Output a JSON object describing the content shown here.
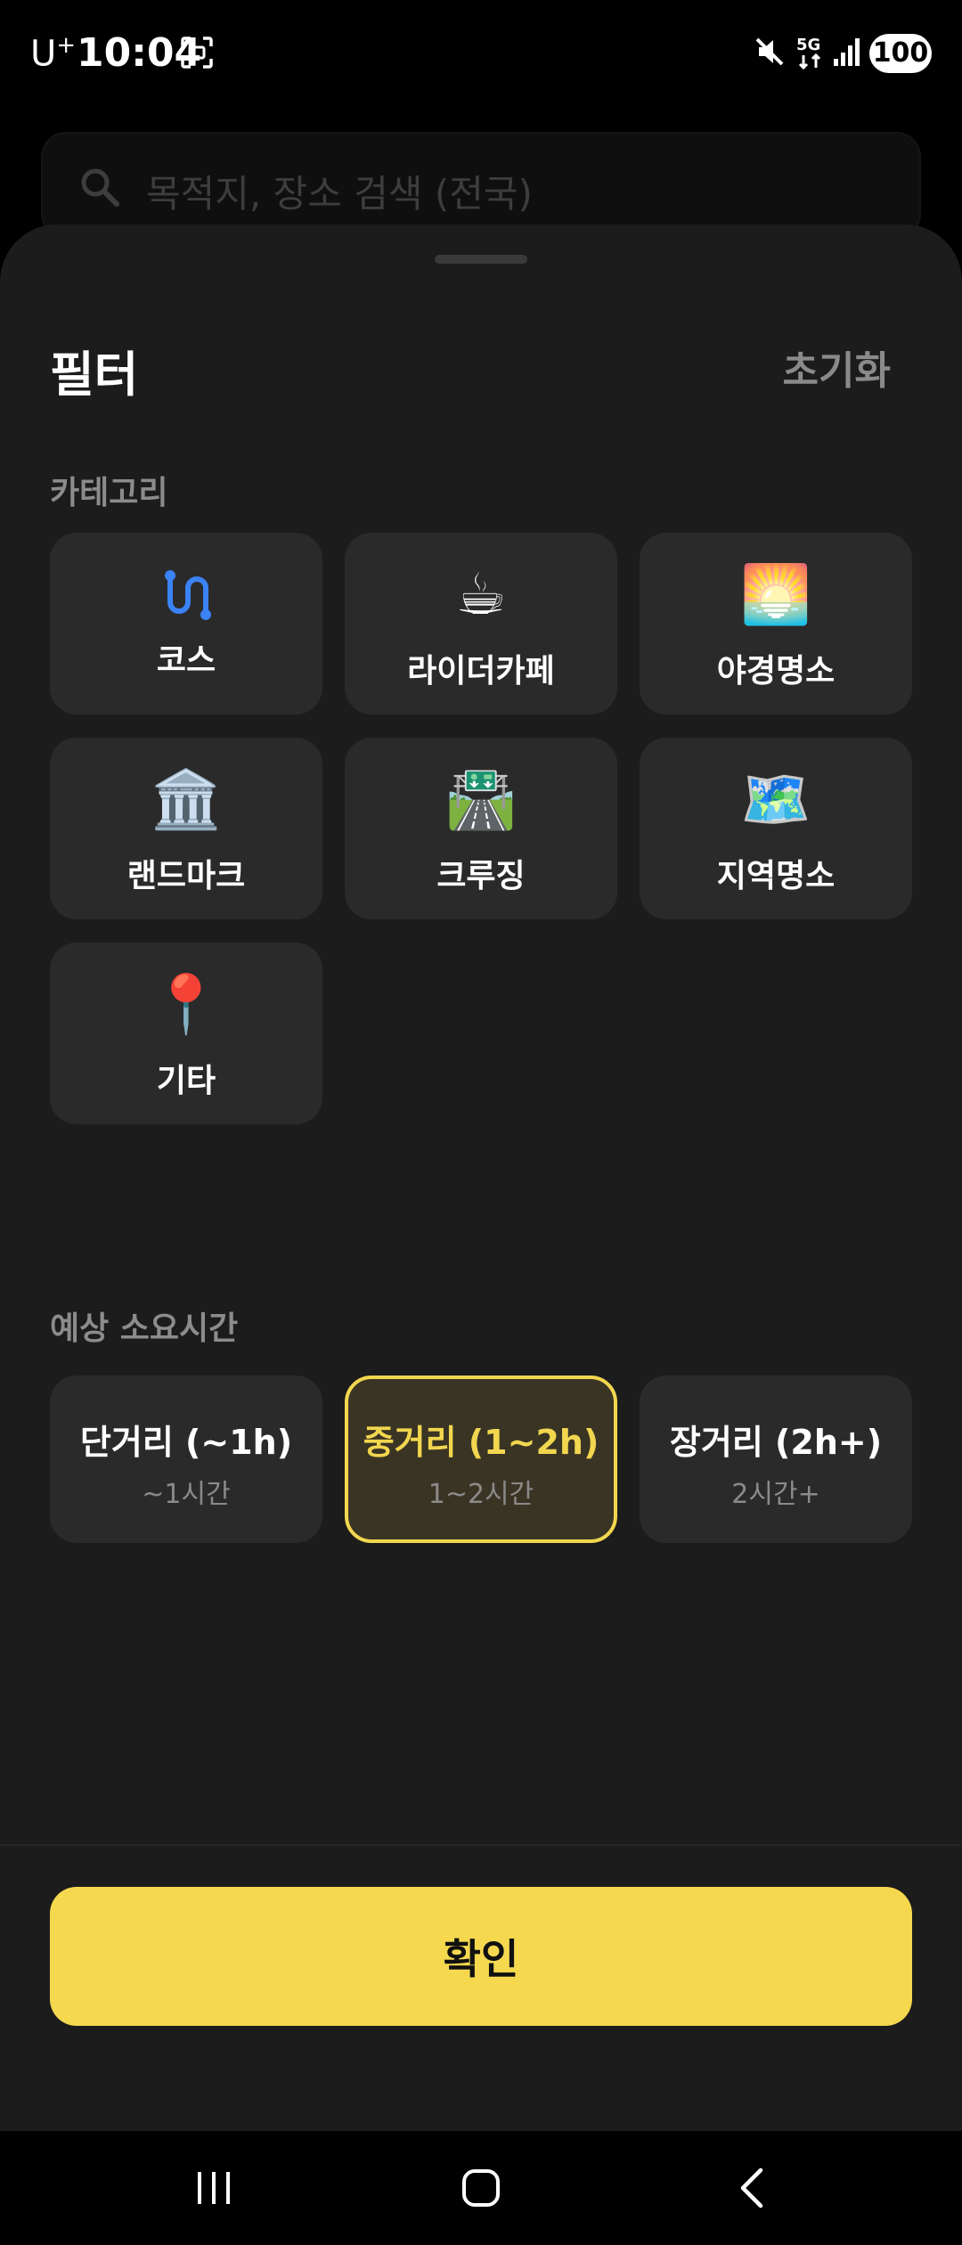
{
  "status_bar": {
    "carrier": "U",
    "carrier_sup": "+",
    "time": "10:04",
    "network": "5G",
    "battery": "100"
  },
  "search": {
    "placeholder": "목적지, 장소 검색 (전국)"
  },
  "sheet": {
    "title": "필터",
    "reset_label": "초기화",
    "category_label": "카테고리",
    "categories": [
      {
        "label": "코스",
        "icon": "route-icon"
      },
      {
        "label": "라이더카페",
        "icon": "coffee-icon",
        "emoji": "☕"
      },
      {
        "label": "야경명소",
        "icon": "sunrise-icon",
        "emoji": "🌅"
      },
      {
        "label": "랜드마크",
        "icon": "classical-building-icon",
        "emoji": "🏛️"
      },
      {
        "label": "크루징",
        "icon": "motorway-icon",
        "emoji": "🛣️"
      },
      {
        "label": "지역명소",
        "icon": "map-icon",
        "emoji": "🗺️"
      },
      {
        "label": "기타",
        "icon": "pin-icon",
        "emoji": "📍"
      }
    ],
    "duration_label": "예상 소요시간",
    "durations": [
      {
        "title": "단거리 (~1h)",
        "sub": "~1시간",
        "selected": false
      },
      {
        "title": "중거리 (1~2h)",
        "sub": "1~2시간",
        "selected": true
      },
      {
        "title": "장거리 (2h+)",
        "sub": "2시간+",
        "selected": false
      }
    ],
    "confirm_label": "확인"
  },
  "colors": {
    "accent": "#F5D84E",
    "sheet_bg": "#1C1C1C",
    "card_bg": "#2A2A2A",
    "route_icon": "#3B82F6"
  }
}
